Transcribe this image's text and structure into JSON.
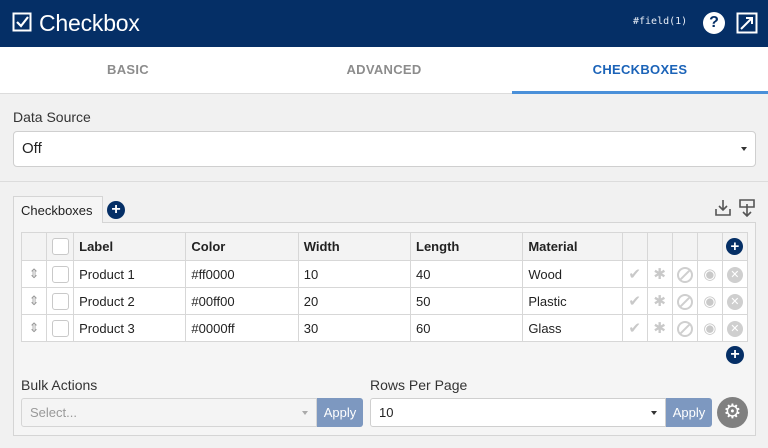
{
  "header": {
    "title": "Checkbox",
    "field_tag": "#field(1)",
    "help_label": "?"
  },
  "tabs": [
    {
      "label": "BASIC",
      "active": false
    },
    {
      "label": "ADVANCED",
      "active": false
    },
    {
      "label": "CHECKBOXES",
      "active": true
    }
  ],
  "data_source": {
    "label": "Data Source",
    "value": "Off"
  },
  "panel": {
    "tab_label": "Checkboxes",
    "table": {
      "columns": [
        "Label",
        "Color",
        "Width",
        "Length",
        "Material"
      ],
      "rows": [
        {
          "label": "Product 1",
          "color": "#ff0000",
          "width": "10",
          "length": "40",
          "material": "Wood"
        },
        {
          "label": "Product 2",
          "color": "#00ff00",
          "width": "20",
          "length": "50",
          "material": "Plastic"
        },
        {
          "label": "Product 3",
          "color": "#0000ff",
          "width": "30",
          "length": "60",
          "material": "Glass"
        }
      ]
    }
  },
  "bulk_actions": {
    "label": "Bulk Actions",
    "placeholder": "Select...",
    "apply_label": "Apply"
  },
  "rows_per_page": {
    "label": "Rows Per Page",
    "value": "10",
    "apply_label": "Apply"
  },
  "colors": {
    "header_bg": "#052f66",
    "active_tab": "#1b63b8",
    "apply_button": "#7d98c0"
  }
}
